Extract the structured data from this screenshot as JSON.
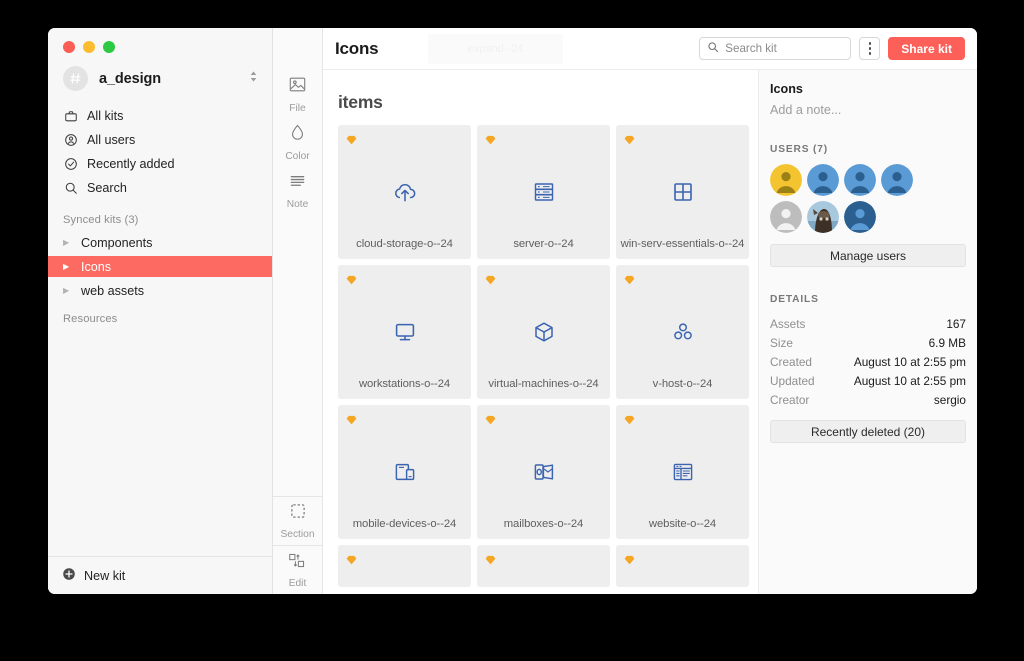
{
  "window": {
    "traffic_lights": [
      "close",
      "minimize",
      "zoom"
    ]
  },
  "sidebar": {
    "team": {
      "name": "a_design",
      "avatar_glyph": "#"
    },
    "nav_items": [
      {
        "label": "All kits",
        "icon": "briefcase-icon"
      },
      {
        "label": "All users",
        "icon": "users-circle-icon"
      },
      {
        "label": "Recently added",
        "icon": "clock-check-icon"
      },
      {
        "label": "Search",
        "icon": "search-icon"
      }
    ],
    "synced_header": "Synced kits (3)",
    "kits": [
      {
        "label": "Components",
        "active": false
      },
      {
        "label": "Icons",
        "active": true
      },
      {
        "label": "web assets",
        "active": false
      }
    ],
    "resources_header": "Resources",
    "new_kit_label": "New kit"
  },
  "rail": {
    "top_tools": [
      {
        "label": "File",
        "icon": "image-icon"
      },
      {
        "label": "Color",
        "icon": "droplet-icon"
      },
      {
        "label": "Note",
        "icon": "lines-icon"
      }
    ],
    "bottom_tools": [
      {
        "label": "Section",
        "icon": "dashed-square-icon"
      },
      {
        "label": "Edit",
        "icon": "swap-squares-icon"
      }
    ]
  },
  "topbar": {
    "title": "Icons",
    "ghost_drag_label": "expand--24",
    "search_placeholder": "Search kit",
    "search_value": "",
    "more_menu_label": "More options",
    "share_label": "Share kit",
    "share_color": "#fc6058"
  },
  "main": {
    "section_title": "items",
    "tiles": [
      {
        "name": "cloud-storage-o--24",
        "icon": "cloud-upload-icon",
        "badge": "sketch-badge"
      },
      {
        "name": "server-o--24",
        "icon": "server-rack-icon",
        "badge": "sketch-badge"
      },
      {
        "name": "win-serv-essentials-o--24",
        "icon": "windows-icon",
        "badge": "sketch-badge"
      },
      {
        "name": "workstations-o--24",
        "icon": "monitor-icon",
        "badge": "sketch-badge"
      },
      {
        "name": "virtual-machines-o--24",
        "icon": "cube-icon",
        "badge": "sketch-badge"
      },
      {
        "name": "v-host-o--24",
        "icon": "cluster-icon",
        "badge": "sketch-badge"
      },
      {
        "name": "mobile-devices-o--24",
        "icon": "devices-icon",
        "badge": "sketch-badge"
      },
      {
        "name": "mailboxes-o--24",
        "icon": "outlook-icon",
        "badge": "sketch-badge"
      },
      {
        "name": "website-o--24",
        "icon": "webpage-icon",
        "badge": "sketch-badge"
      }
    ],
    "partial_tiles": [
      {
        "badge": "sketch-badge"
      },
      {
        "badge": "sketch-badge"
      },
      {
        "badge": "sketch-badge"
      }
    ],
    "icon_color": "#3a64b0",
    "badge_color": "#f5a623"
  },
  "inspector": {
    "title": "Icons",
    "note_placeholder": "Add a note...",
    "users_header": "USERS (7)",
    "avatars": [
      {
        "type": "silhouette",
        "bg": "#f4c430",
        "fg": "#9a8015"
      },
      {
        "type": "silhouette",
        "bg": "#5b9bd5",
        "fg": "#2a5f8f"
      },
      {
        "type": "silhouette",
        "bg": "#5b9bd5",
        "fg": "#2a5f8f"
      },
      {
        "type": "silhouette",
        "bg": "#5b9bd5",
        "fg": "#2a5f8f"
      },
      {
        "type": "silhouette",
        "bg": "#bdbdbd",
        "fg": "#f0f0f0"
      },
      {
        "type": "photo",
        "bg": "#8fb8cf",
        "fg": "#4a3a2c"
      },
      {
        "type": "silhouette",
        "bg": "#2a5f8f",
        "fg": "#5b9bd5"
      }
    ],
    "manage_users_label": "Manage users",
    "details_header": "DETAILS",
    "details": [
      {
        "key": "Assets",
        "value": "167"
      },
      {
        "key": "Size",
        "value": "6.9 MB"
      },
      {
        "key": "Created",
        "value": "August 10 at 2:55 pm"
      },
      {
        "key": "Updated",
        "value": "August 10 at 2:55 pm"
      },
      {
        "key": "Creator",
        "value": "sergio"
      }
    ],
    "recently_deleted_label": "Recently deleted (20)"
  }
}
